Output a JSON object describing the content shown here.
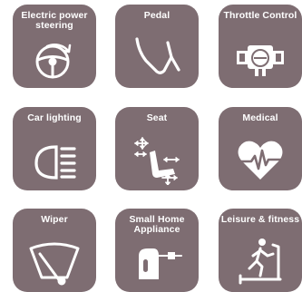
{
  "colors": {
    "tile_background": "#7e6d72",
    "text": "#ffffff"
  },
  "tiles": [
    {
      "label": "Electric power steering",
      "icon": "steering-wheel-icon"
    },
    {
      "label": "Pedal",
      "icon": "pedal-icon"
    },
    {
      "label": "Throttle Control",
      "icon": "throttle-body-icon"
    },
    {
      "label": "Car lighting",
      "icon": "headlight-icon"
    },
    {
      "label": "Seat",
      "icon": "seat-adjust-icon"
    },
    {
      "label": "Medical",
      "icon": "heartbeat-icon"
    },
    {
      "label": "Wiper",
      "icon": "wiper-icon"
    },
    {
      "label": "Small Home Appliance",
      "icon": "hand-mixer-icon"
    },
    {
      "label": "Leisure & fitness",
      "icon": "treadmill-icon"
    }
  ]
}
